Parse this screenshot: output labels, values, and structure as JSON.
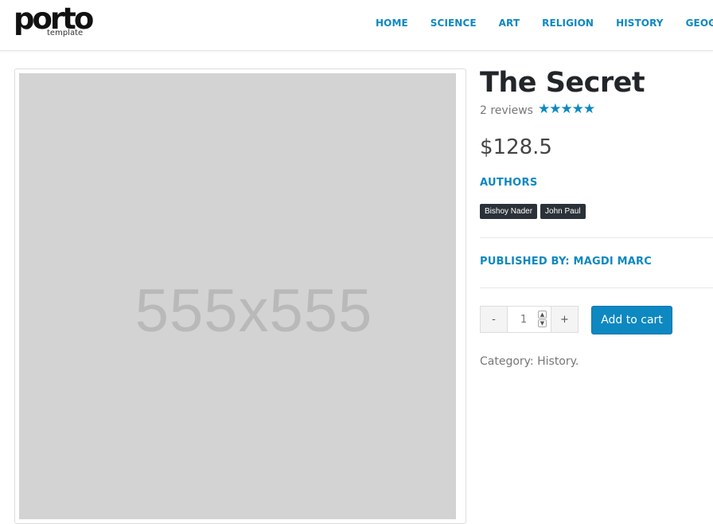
{
  "header": {
    "logo": {
      "word": "porto",
      "tagline": "template"
    },
    "nav": [
      "HOME",
      "SCIENCE",
      "ART",
      "RELIGION",
      "HISTORY",
      "GEOGRAPHY"
    ]
  },
  "product": {
    "image_placeholder": "555x555",
    "title": "The Secret",
    "reviews": "2 reviews",
    "rating": 5,
    "stars": "★★★★★",
    "price": "$128.5",
    "authors_heading": "AUTHORS",
    "authors": [
      "Bishoy Nader",
      "John Paul"
    ],
    "publisher": "PUBLISHED BY: MAGDI MARC",
    "quantity": {
      "minus": "-",
      "value": "1",
      "plus": "+",
      "spin_up": "^",
      "spin_down": "v"
    },
    "add_to_cart": "Add to cart",
    "category_label": "Category:",
    "category_value": "History",
    "category_end": "."
  },
  "colors": {
    "accent": "#0d88c1",
    "tag_bg": "#2b3138",
    "placeholder_bg": "#d3d3d3"
  }
}
